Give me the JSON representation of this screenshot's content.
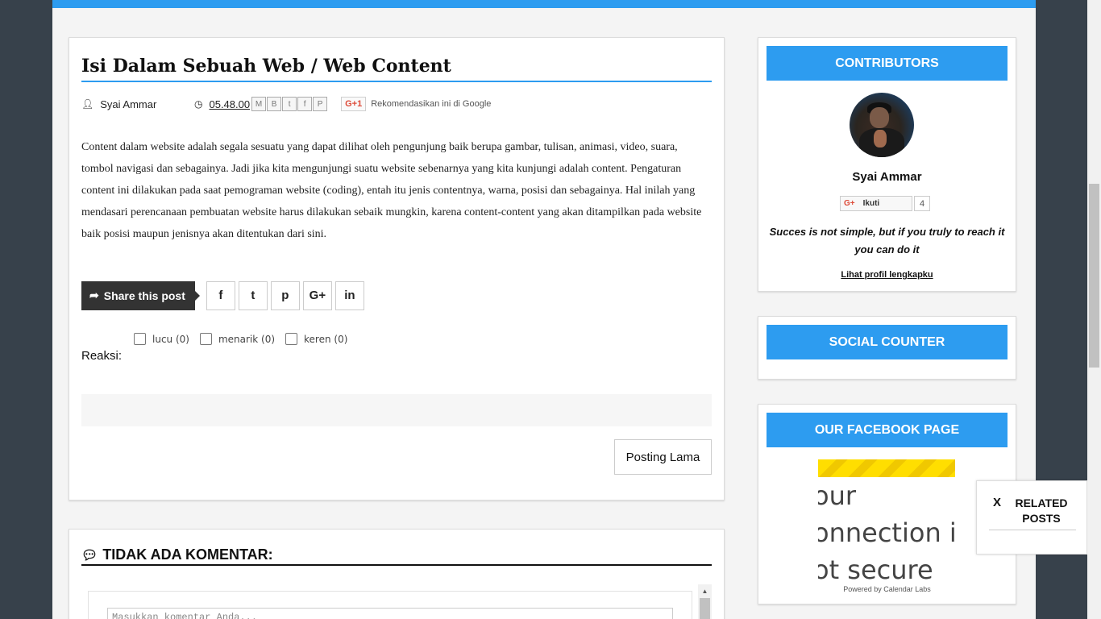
{
  "colors": {
    "accent": "#2d9cf0",
    "background": "#37414b"
  },
  "post": {
    "title": "Isi Dalam Sebuah Web / Web Content",
    "author": "Syai Ammar",
    "time": "05.48.00",
    "share_icons": [
      "email-icon",
      "blogger-icon",
      "twitter-icon",
      "facebook-icon",
      "pinterest-icon"
    ],
    "gplus_label": "G+1",
    "recommend_text": "Rekomendasikan ini di Google",
    "body": "Content dalam website adalah segala sesuatu yang dapat dilihat oleh pengunjung baik berupa gambar, tulisan, animasi, video, suara, tombol navigasi dan sebagainya. Jadi jika kita mengunjungi suatu website sebenarnya yang kita kunjungi adalah content. Pengaturan content ini dilakukan pada saat pemograman website (coding), entah itu jenis contentnya, warna, posisi dan sebagainya. Hal inilah yang mendasari perencanaan pembuatan website harus dilakukan sebaik mungkin, karena content-content yang akan ditampilkan pada website baik posisi maupun jenisnya akan ditentukan dari sini.",
    "share_label": "Share this post",
    "share_buttons": [
      "f",
      "t",
      "p",
      "G+",
      "in"
    ],
    "reaksi_label": "Reaksi:",
    "reactions": [
      "lucu (0)",
      "menarik (0)",
      "keren (0)"
    ],
    "older_label": "Posting Lama"
  },
  "comments": {
    "title": "TIDAK ADA KOMENTAR:",
    "placeholder": "Masukkan komentar Anda..."
  },
  "sidebar": {
    "contributors": {
      "title": "CONTRIBUTORS",
      "name": "Syai Ammar",
      "follow_label": "Ikuti",
      "follow_count": "4",
      "quote": "Succes is not simple, but if you truly to reach it you can do it",
      "profile_link": "Lihat profil lengkapku"
    },
    "social_counter": {
      "title": "SOCIAL COUNTER"
    },
    "facebook": {
      "title": "OUR FACEBOOK PAGE",
      "frame_text": [
        "our",
        "onnection is",
        "ot secure"
      ],
      "powered": "Powered by Calendar Labs"
    }
  },
  "related": {
    "close": "X",
    "label": "RELATED POSTS"
  }
}
